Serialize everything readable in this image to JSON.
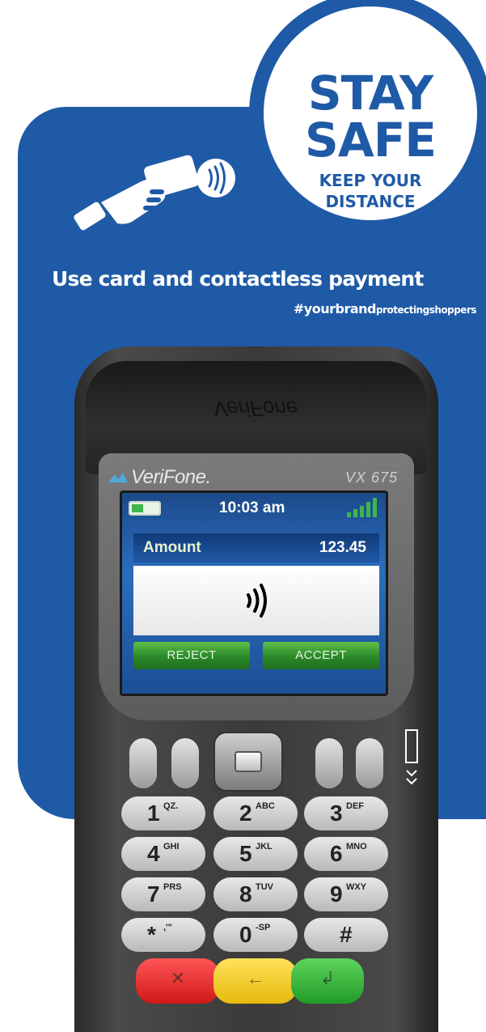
{
  "badge": {
    "line1": "STAY",
    "line2": "SAFE",
    "line3": "KEEP YOUR",
    "line4": "DISTANCE"
  },
  "headline": "Use card and contactless payment",
  "hashtag": {
    "big": "#yourbrand",
    "small": "protectingshoppers"
  },
  "terminal": {
    "printer_logo": "VeriFone",
    "brand": "VeriFone.",
    "model": "VX 675",
    "screen": {
      "time": "10:03 am",
      "amount_label": "Amount",
      "amount_value": "123.45",
      "reject_label": "REJECT",
      "accept_label": "ACCEPT"
    },
    "keys": [
      {
        "num": "1",
        "letters": "QZ."
      },
      {
        "num": "2",
        "letters": "ABC"
      },
      {
        "num": "3",
        "letters": "DEF"
      },
      {
        "num": "4",
        "letters": "GHI"
      },
      {
        "num": "5",
        "letters": "JKL"
      },
      {
        "num": "6",
        "letters": "MNO"
      },
      {
        "num": "7",
        "letters": "PRS"
      },
      {
        "num": "8",
        "letters": "TUV"
      },
      {
        "num": "9",
        "letters": "WXY"
      },
      {
        "num": "*",
        "letters": ",'\""
      },
      {
        "num": "0",
        "letters": "-SP"
      },
      {
        "num": "#",
        "letters": ""
      }
    ]
  },
  "colors": {
    "brand_blue": "#1f5aa6",
    "cancel_red": "#d11818",
    "clear_yellow": "#e7b90c",
    "enter_green": "#219c28"
  }
}
